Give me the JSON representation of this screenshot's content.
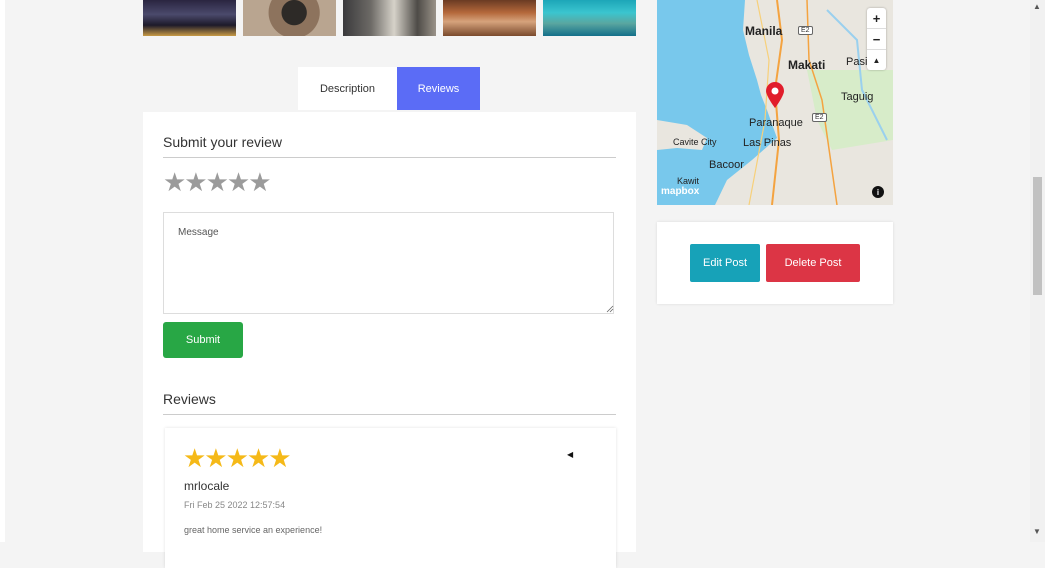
{
  "tabs": {
    "description": "Description",
    "reviews": "Reviews"
  },
  "submit_section": {
    "heading": "Submit your review",
    "rating_stars": "★★★★★",
    "message_placeholder": "Message",
    "submit_label": "Submit"
  },
  "reviews_section": {
    "heading": "Reviews",
    "items": [
      {
        "stars": "★★★★★",
        "rating": 5,
        "author": "mrlocale",
        "date": "Fri Feb 25 2022 12:57:54",
        "text": "great home service an experience!"
      }
    ]
  },
  "map": {
    "labels": {
      "manila": "Manila",
      "makati": "Makati",
      "pasig": "Pasi",
      "taguig": "Taguig",
      "paranaque": "Paranaque",
      "cavite_city": "Cavite City",
      "las_pinas": "Las Pinas",
      "bacoor": "Bacoor",
      "kawit": "Kawit",
      "highway_e2": "E2"
    },
    "zoom_in": "+",
    "zoom_out": "−",
    "compass": "▲",
    "logo": "mapbox",
    "info": "i"
  },
  "actions": {
    "edit_label": "Edit Post",
    "delete_label": "Delete Post"
  },
  "colors": {
    "tab_active": "#5b6cf6",
    "submit": "#28a745",
    "edit": "#17a2b8",
    "delete": "#dc3545",
    "star_filled": "#f5b918",
    "star_empty": "#9b9b9b",
    "water": "#78c8ec",
    "pin": "#e11d2b"
  },
  "icons": {
    "map_pin": "map-pin-icon",
    "zoom_in": "plus-icon",
    "zoom_out": "minus-icon",
    "compass": "compass-icon",
    "info": "info-icon",
    "caret": "caret-left-icon"
  }
}
